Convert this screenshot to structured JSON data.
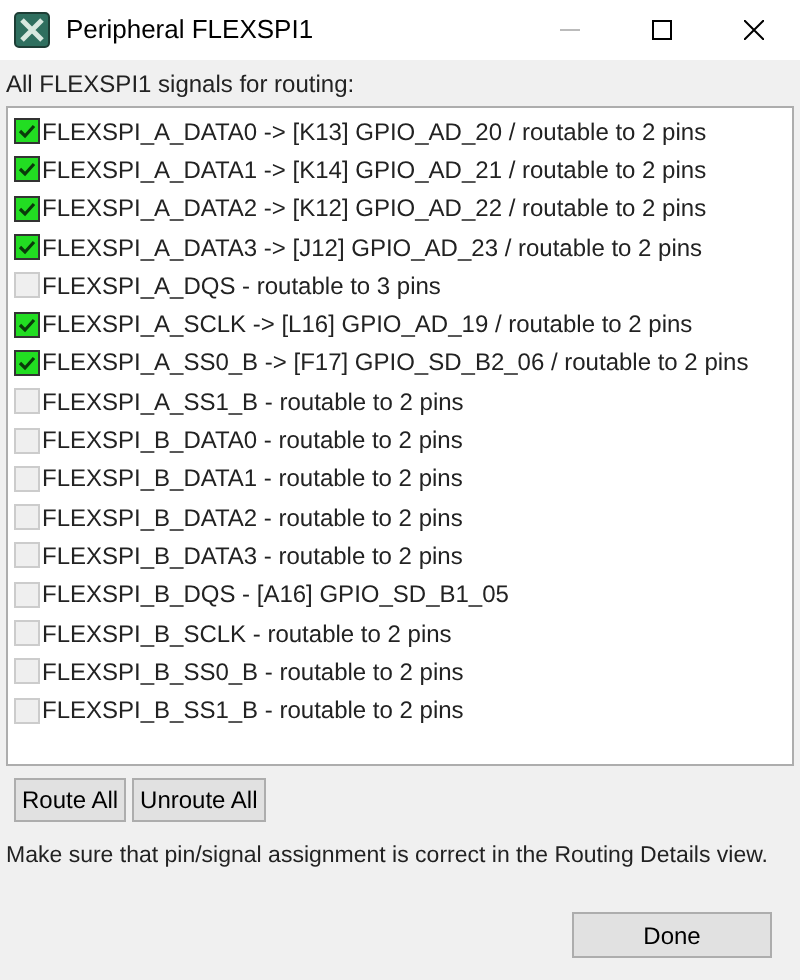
{
  "window": {
    "title": "Peripheral FLEXSPI1"
  },
  "list_label": "All FLEXSPI1 signals for routing:",
  "signals": [
    {
      "label": "FLEXSPI_A_DATA0 -> [K13] GPIO_AD_20 / routable to 2 pins",
      "checked": true
    },
    {
      "label": "FLEXSPI_A_DATA1 -> [K14] GPIO_AD_21 / routable to 2 pins",
      "checked": true
    },
    {
      "label": "FLEXSPI_A_DATA2 -> [K12] GPIO_AD_22 / routable to 2 pins",
      "checked": true
    },
    {
      "label": "FLEXSPI_A_DATA3 -> [J12] GPIO_AD_23 / routable to 2 pins",
      "checked": true
    },
    {
      "label": "FLEXSPI_A_DQS - routable to 3 pins",
      "checked": false
    },
    {
      "label": "FLEXSPI_A_SCLK -> [L16] GPIO_AD_19 / routable to 2 pins",
      "checked": true
    },
    {
      "label": "FLEXSPI_A_SS0_B -> [F17] GPIO_SD_B2_06 / routable to 2 pins",
      "checked": true
    },
    {
      "label": "FLEXSPI_A_SS1_B - routable to 2 pins",
      "checked": false
    },
    {
      "label": "FLEXSPI_B_DATA0 - routable to 2 pins",
      "checked": false
    },
    {
      "label": "FLEXSPI_B_DATA1 - routable to 2 pins",
      "checked": false
    },
    {
      "label": "FLEXSPI_B_DATA2 - routable to 2 pins",
      "checked": false
    },
    {
      "label": "FLEXSPI_B_DATA3 - routable to 2 pins",
      "checked": false
    },
    {
      "label": "FLEXSPI_B_DQS - [A16] GPIO_SD_B1_05",
      "checked": false
    },
    {
      "label": "FLEXSPI_B_SCLK - routable to 2 pins",
      "checked": false
    },
    {
      "label": "FLEXSPI_B_SS0_B - routable to 2 pins",
      "checked": false
    },
    {
      "label": "FLEXSPI_B_SS1_B - routable to 2 pins",
      "checked": false
    }
  ],
  "buttons": [
    "Route All",
    "Unroute All"
  ],
  "message": "Make sure that pin/signal assignment is correct in the Routing Details view.",
  "done_button": "Done"
}
